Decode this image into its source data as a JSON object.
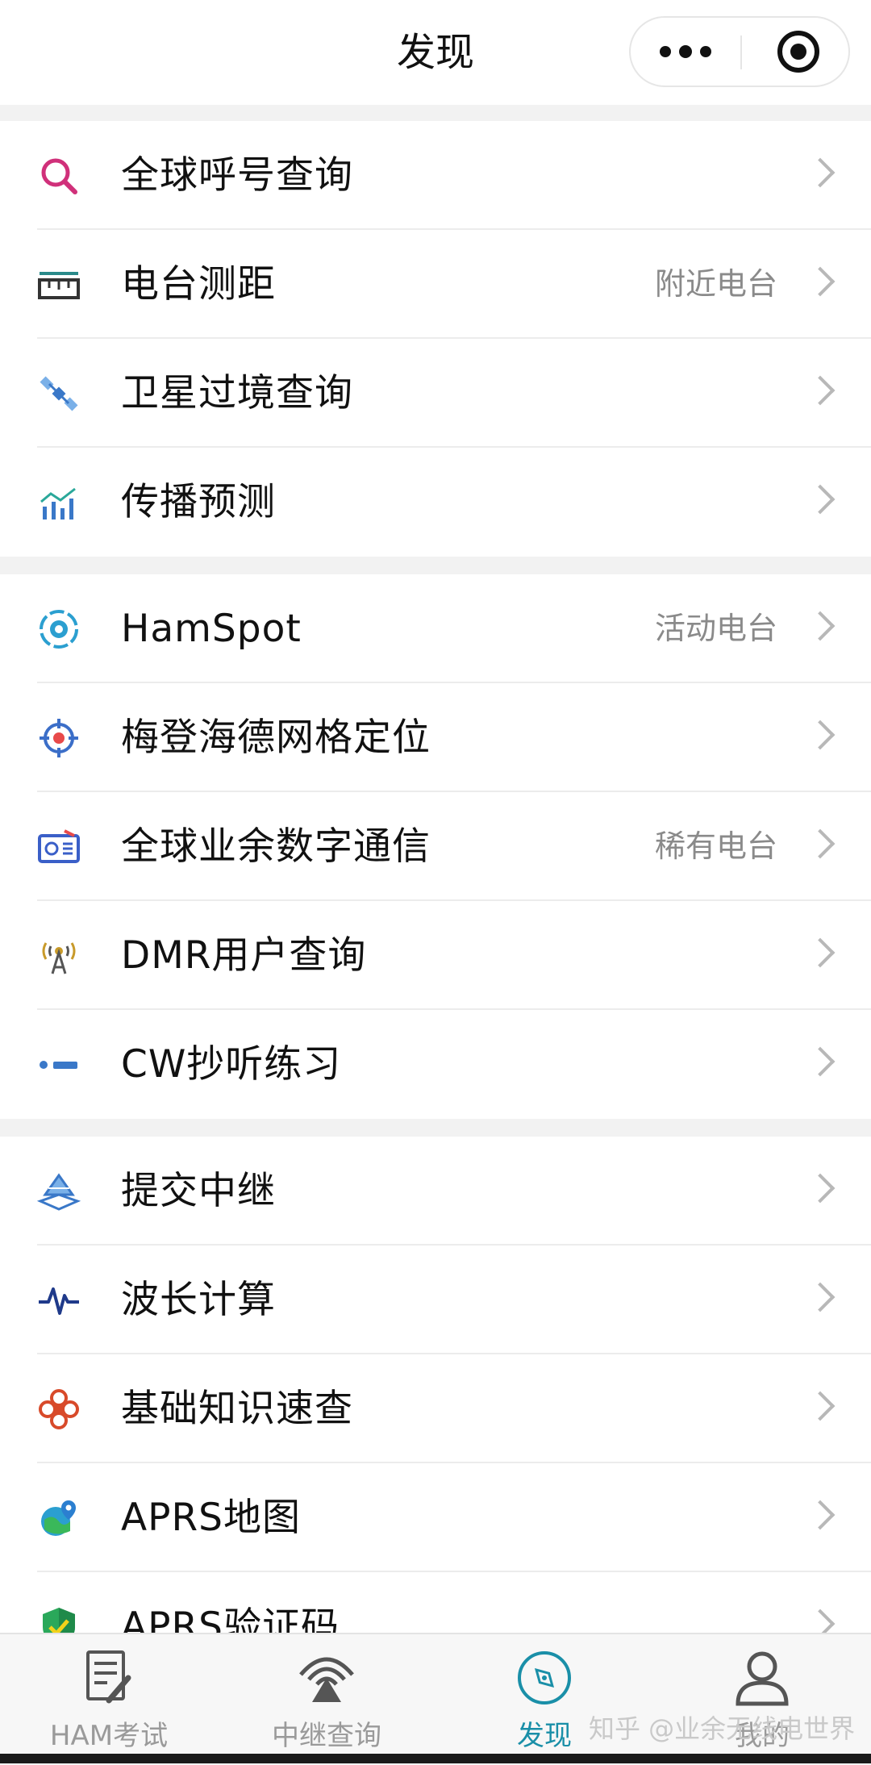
{
  "header": {
    "title": "发现"
  },
  "groups": [
    [
      {
        "label": "全球呼号查询",
        "extra": "",
        "icon": "search-icon",
        "color": "#d0307a"
      },
      {
        "label": "电台测距",
        "extra": "附近电台",
        "icon": "ruler-icon",
        "color": "#2a8a8a"
      },
      {
        "label": "卫星过境查询",
        "extra": "",
        "icon": "satellite-icon",
        "color": "#3a78c8"
      },
      {
        "label": "传播预测",
        "extra": "",
        "icon": "chart-icon",
        "color": "#2aa89a"
      }
    ],
    [
      {
        "label": "HamSpot",
        "extra": "活动电台",
        "icon": "target-icon",
        "color": "#2b9fd0"
      },
      {
        "label": "梅登海德网格定位",
        "extra": "",
        "icon": "crosshair-icon",
        "color": "#3b6ec8"
      },
      {
        "label": "全球业余数字通信",
        "extra": "稀有电台",
        "icon": "radio-icon",
        "color": "#3a5fc8"
      },
      {
        "label": "DMR用户查询",
        "extra": "",
        "icon": "antenna-icon",
        "color": "#c89a2a"
      },
      {
        "label": "CW抄听练习",
        "extra": "",
        "icon": "morse-icon",
        "color": "#3a78c8"
      }
    ],
    [
      {
        "label": "提交中继",
        "extra": "",
        "icon": "layers-icon",
        "color": "#3a78c8"
      },
      {
        "label": "波长计算",
        "extra": "",
        "icon": "waveform-icon",
        "color": "#1f3a8a"
      },
      {
        "label": "基础知识速查",
        "extra": "",
        "icon": "flower-icon",
        "color": "#d84a2a"
      },
      {
        "label": "APRS地图",
        "extra": "",
        "icon": "globe-icon",
        "color": "#2b9fd0"
      },
      {
        "label": "APRS验证码",
        "extra": "",
        "icon": "shield-icon",
        "color": "#2aa85a"
      }
    ]
  ],
  "tabs": [
    {
      "label": "HAM考试"
    },
    {
      "label": "中继查询"
    },
    {
      "label": "发现"
    },
    {
      "label": "我的"
    }
  ],
  "watermark": "知乎 @业余无线电世界",
  "colors": {
    "accent": "#1a8fa8",
    "inactive": "#9a9a9a"
  }
}
